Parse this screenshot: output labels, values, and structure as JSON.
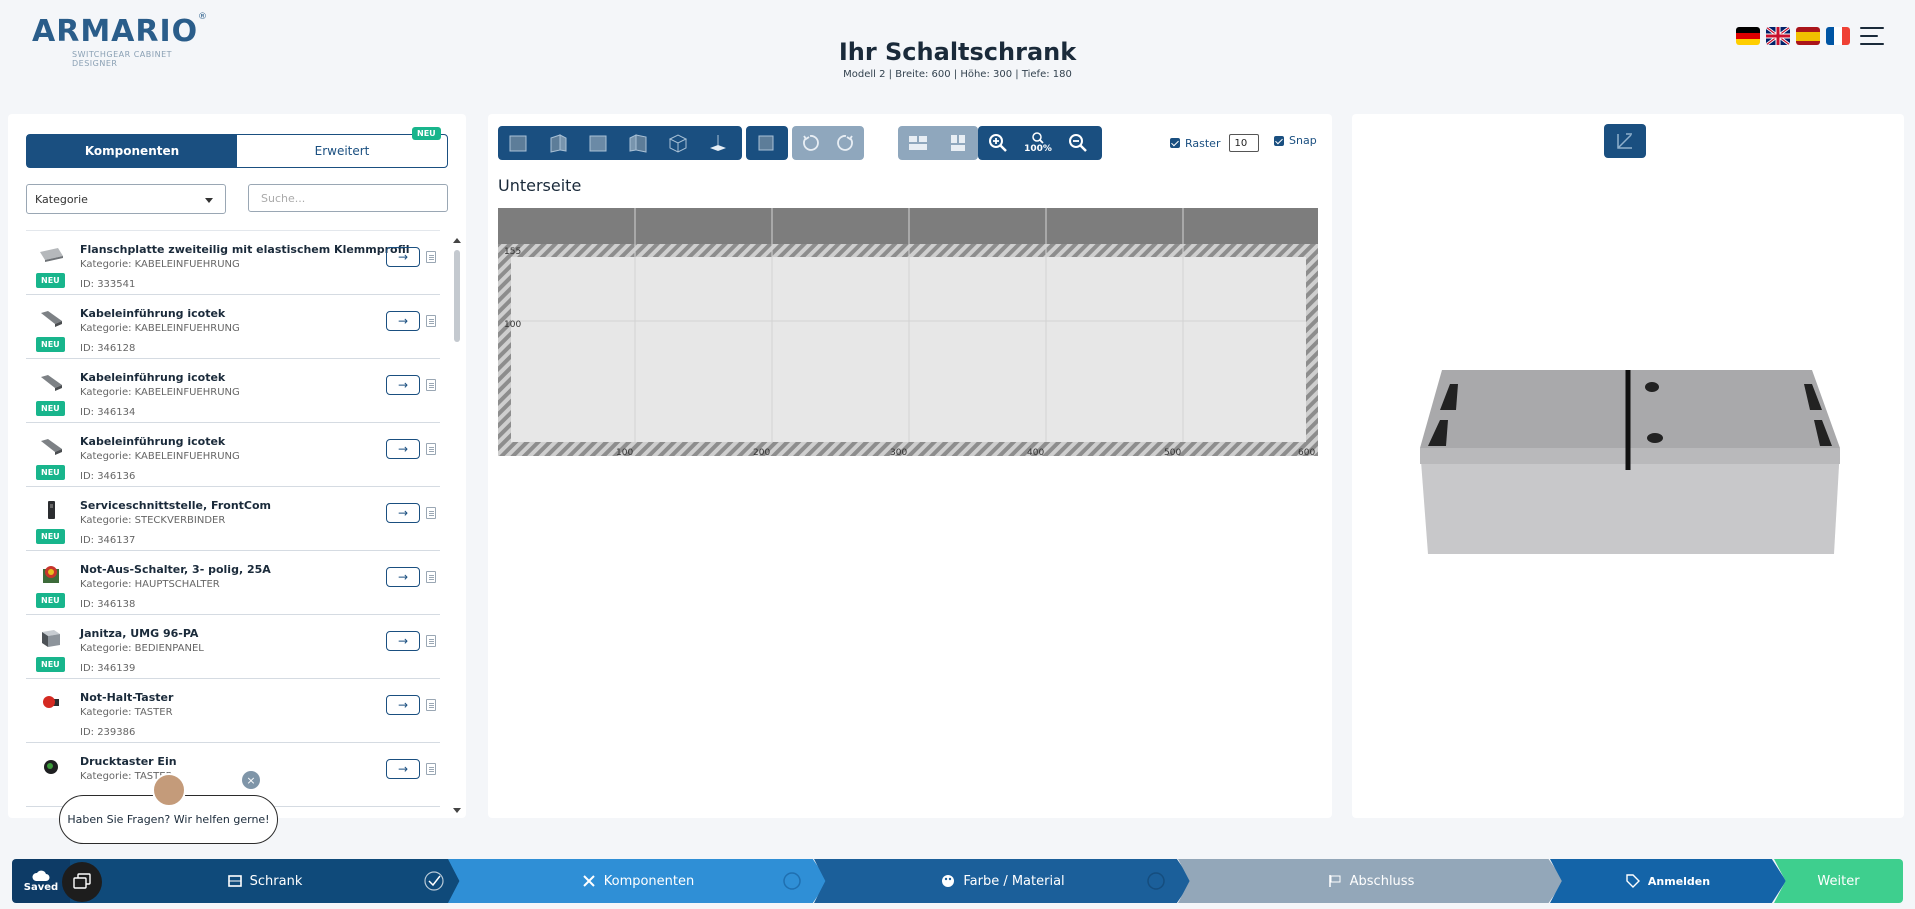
{
  "header": {
    "logo_text": "ARMARIO",
    "logo_subtitle": "SWITCHGEAR CABINET DESIGNER",
    "title": "Ihr Schaltschrank",
    "subtitle": "Modell 2 | Breite: 600 | Höhe: 300 | Tiefe: 180",
    "languages": [
      "de",
      "en",
      "es",
      "fr"
    ]
  },
  "left_panel": {
    "tabs": [
      {
        "label": "Komponenten",
        "active": true
      },
      {
        "label": "Erweitert",
        "active": false
      }
    ],
    "tab_badge": "NEU",
    "category_select": "Kategorie",
    "search_placeholder": "Suche...",
    "items": [
      {
        "name": "Flanschplatte zweiteilig mit elastischem Klemmprofil",
        "category": "Kategorie: KABELEINFUEHRUNG",
        "id": "ID: 333541",
        "badge": "NEU",
        "icon": "flange-plate-thumb"
      },
      {
        "name": "Kabeleinführung icotek",
        "category": "Kategorie: KABELEINFUEHRUNG",
        "id": "ID: 346128",
        "badge": "NEU",
        "icon": "cable-entry-thumb"
      },
      {
        "name": "Kabeleinführung icotek",
        "category": "Kategorie: KABELEINFUEHRUNG",
        "id": "ID: 346134",
        "badge": "NEU",
        "icon": "cable-entry-thumb"
      },
      {
        "name": "Kabeleinführung icotek",
        "category": "Kategorie: KABELEINFUEHRUNG",
        "id": "ID: 346136",
        "badge": "NEU",
        "icon": "cable-entry-thumb"
      },
      {
        "name": "Serviceschnittstelle, FrontCom",
        "category": "Kategorie: STECKVERBINDER",
        "id": "ID: 346137",
        "badge": "NEU",
        "icon": "connector-thumb"
      },
      {
        "name": "Not-Aus-Schalter, 3- polig, 25A",
        "category": "Kategorie: HAUPTSCHALTER",
        "id": "ID: 346138",
        "badge": "NEU",
        "icon": "emergency-switch-thumb"
      },
      {
        "name": "Janitza, UMG 96-PA",
        "category": "Kategorie: BEDIENPANEL",
        "id": "ID: 346139",
        "badge": "NEU",
        "icon": "meter-thumb"
      },
      {
        "name": "Not-Halt-Taster",
        "category": "Kategorie: TASTER",
        "id": "ID: 239386",
        "badge": "",
        "icon": "emergency-button-thumb"
      },
      {
        "name": "Drucktaster Ein",
        "category": "Kategorie: TASTER",
        "id": "",
        "badge": "",
        "icon": "push-button-thumb"
      }
    ]
  },
  "toolbar": {
    "zoom_level": "100%",
    "raster_label": "Raster",
    "raster_value": "10",
    "snap_label": "Snap"
  },
  "canvas": {
    "view_label": "Unterseite",
    "x_ticks": [
      "100",
      "200",
      "300",
      "400",
      "500",
      "600"
    ],
    "y_ticks": [
      "155",
      "100"
    ]
  },
  "chat": {
    "message": "Haben Sie Fragen? Wir helfen gerne!",
    "close": "×"
  },
  "footer": {
    "saved_label": "Saved",
    "steps": [
      {
        "label": "Schrank",
        "color": "#0f4a7a",
        "icon": "cabinet-icon"
      },
      {
        "label": "Komponenten",
        "color": "#2f8fd6",
        "icon": "tools-icon"
      },
      {
        "label": "Farbe / Material",
        "color": "#1b5f9a",
        "icon": "palette-icon"
      },
      {
        "label": "Abschluss",
        "color": "#93a7b9",
        "icon": "flag-icon"
      },
      {
        "label": "Anmelden",
        "color": "#1464a8",
        "icon": "tag-icon"
      },
      {
        "label": "Weiter",
        "color": "#3ecf8e",
        "icon": ""
      }
    ]
  }
}
